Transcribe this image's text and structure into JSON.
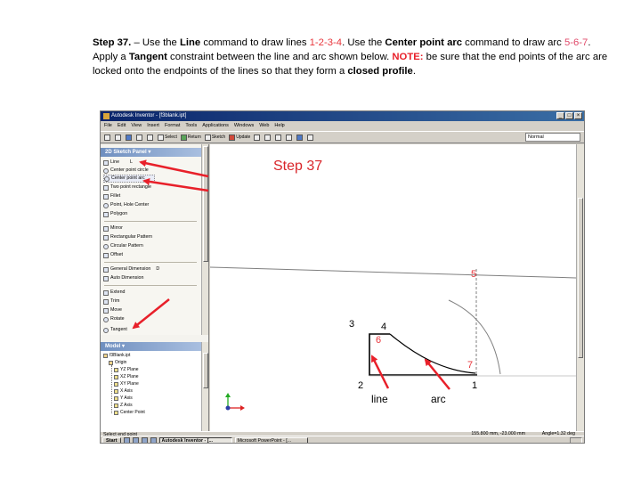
{
  "instruction": {
    "step": "Step 37.",
    "t1": " – Use the ",
    "line_cmd": "Line",
    "t2": " command to draw lines ",
    "lines_ref": "1-2-3-4",
    "t3": ". Use the ",
    "arc_cmd": "Center point arc",
    "t4": " command to draw arc ",
    "arc_ref": "5-6-7",
    "t5": ". Apply a ",
    "tangent": "Tangent",
    "t6": " constraint between the line and arc shown below. ",
    "note": "NOTE:",
    "t7": " be sure that the end points of the arc are locked onto the endpoints of the lines so that they form a ",
    "closed": "closed profile",
    "t8": "."
  },
  "window": {
    "title": "Autodesk Inventor - [f3blank.ipt]",
    "menu": [
      "File",
      "Edit",
      "View",
      "Insert",
      "Format",
      "Tools",
      "Applications",
      "Windows",
      "Web",
      "Help"
    ],
    "toolbar": [
      "Select",
      "Return",
      "Sketch",
      "Update"
    ],
    "style_combo": "Normal"
  },
  "sketch_panel": {
    "title": "2D Sketch Panel",
    "items": [
      "Line",
      "Center point circle",
      "Center point arc",
      "Two point rectangle",
      "Fillet",
      "Point, Hole Center",
      "Polygon",
      "Mirror",
      "Rectangular Pattern",
      "Circular Pattern",
      "Offset",
      "General Dimension",
      "Auto Dimension",
      "Extend",
      "Trim",
      "Move",
      "Rotate",
      "Tangent"
    ],
    "shortcut_line": "L",
    "shortcut_dim": "D"
  },
  "model_panel": {
    "title": "Model",
    "items": [
      "f3Blank.ipt",
      "Origin",
      "YZ Plane",
      "XZ Plane",
      "XY Plane",
      "X Axis",
      "Y Axis",
      "Z Axis",
      "Center Point"
    ]
  },
  "canvas": {
    "step_label": "Step 37",
    "points": {
      "p1": "1",
      "p2": "2",
      "p3": "3",
      "p4": "4",
      "p5": "5",
      "p6": "6",
      "p7": "7"
    },
    "callout_line": "line",
    "callout_arc": "arc"
  },
  "status": {
    "prompt": "Select end point",
    "coords": "155.800 mm, -23.000 mm",
    "angle": "Angle=1.32 deg"
  },
  "taskbar": {
    "start": "Start",
    "tasks": [
      "Autodesk Inventor - [...",
      "Microsoft PowerPoint - [..."
    ]
  },
  "colors": {
    "accent_red": "#e8353b",
    "sketch_line": "#000000",
    "construction": "#7f7f7f"
  }
}
